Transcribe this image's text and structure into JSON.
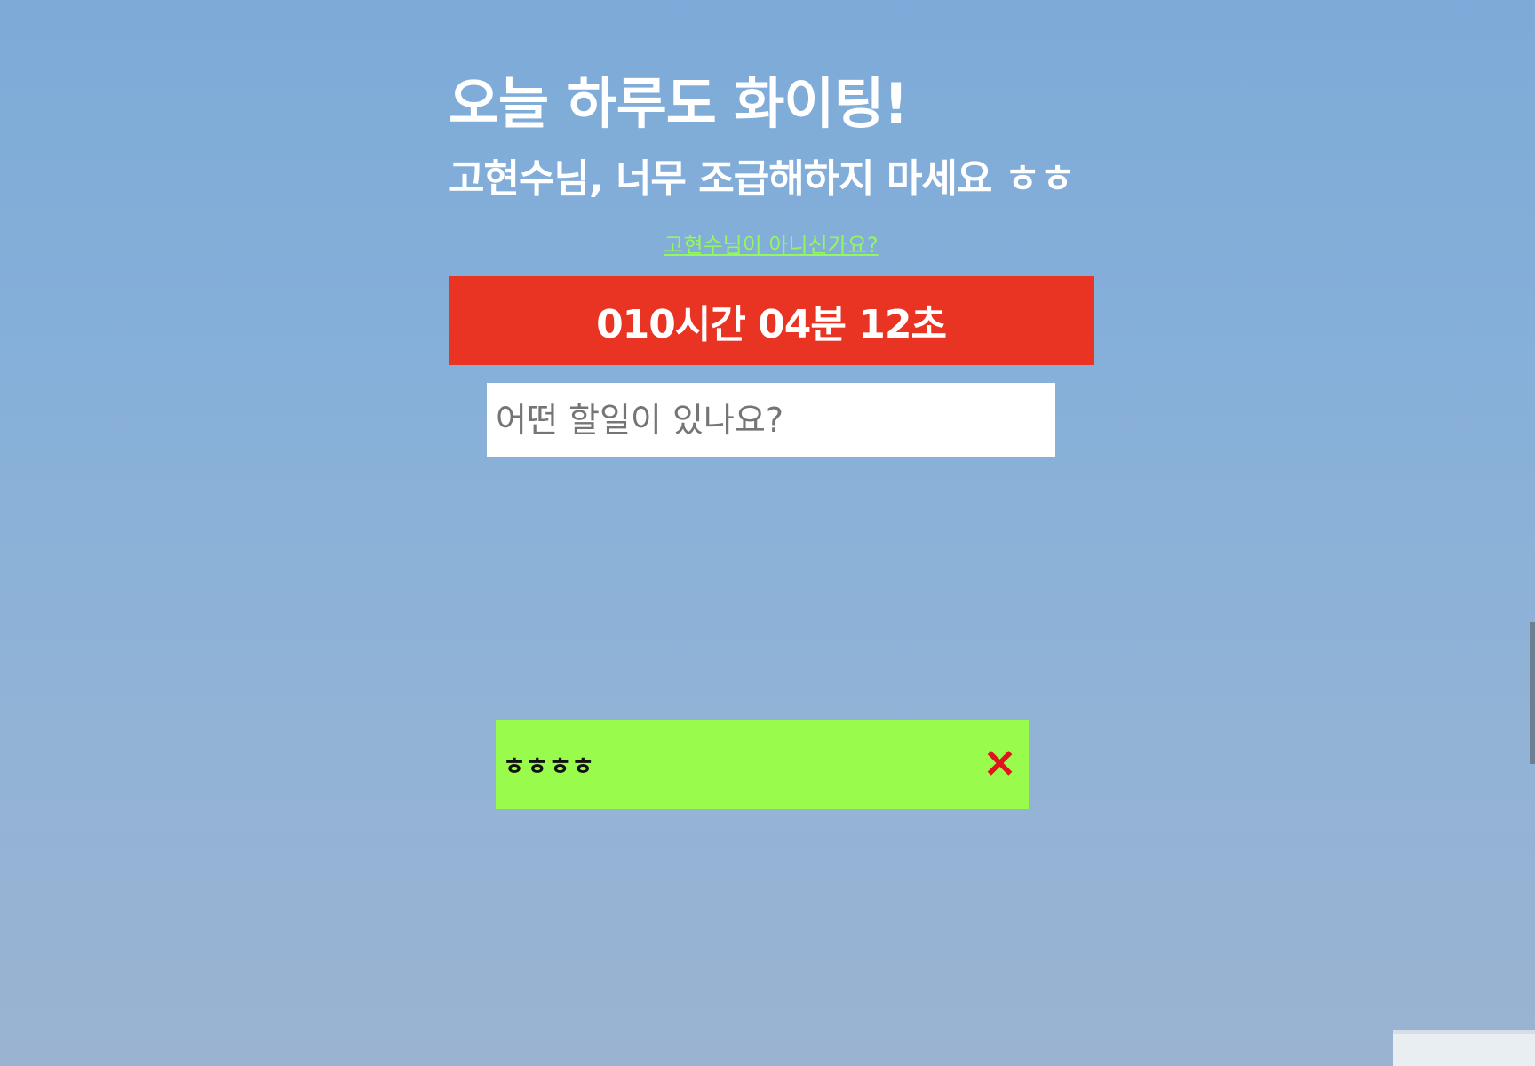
{
  "greeting": {
    "title": "오늘 하루도 화이팅!",
    "subtitle": "고현수님, 너무 조급해하지 마세요 ㅎㅎ",
    "change_user_link": "고현수님이 아니신가요?"
  },
  "clock": {
    "text": "010시간 04분 12초",
    "color": "#e93423"
  },
  "todo_form": {
    "placeholder": "어떤 할일이 있나요?"
  },
  "todos": [
    {
      "text": "ㅎㅎㅎㅎ",
      "delete_label": "✕",
      "color": "#99fb4b"
    }
  ],
  "accent_colors": {
    "link": "#93f85c",
    "delete": "#e0141e"
  }
}
